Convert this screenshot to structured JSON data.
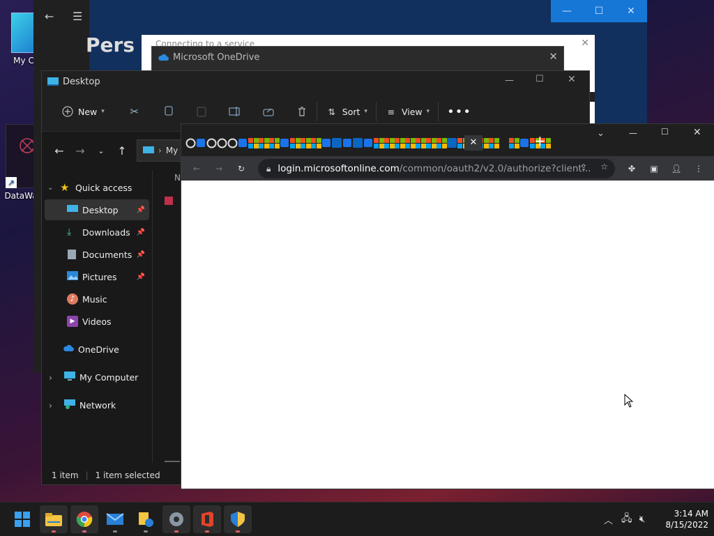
{
  "desktop": {
    "icons": [
      {
        "label": "My C"
      },
      {
        "label": "DataWa"
      }
    ]
  },
  "settings_window": {
    "title": "Pers",
    "controls": {
      "minimize": "—",
      "maximize": "☐",
      "close": "✕"
    }
  },
  "onedrive_back": {
    "status": "Connecting to a service"
  },
  "onedrive_dialog": {
    "title": "Microsoft OneDrive"
  },
  "explorer": {
    "title": "Desktop",
    "toolbar": {
      "new_label": "New",
      "sort_label": "Sort",
      "view_label": "View"
    },
    "address": {
      "path_segment": "My"
    },
    "nav": {
      "quick_access": "Quick access",
      "items": [
        {
          "label": "Desktop",
          "pinned": true
        },
        {
          "label": "Downloads",
          "pinned": true
        },
        {
          "label": "Documents",
          "pinned": true
        },
        {
          "label": "Pictures",
          "pinned": true
        },
        {
          "label": "Music",
          "pinned": false
        },
        {
          "label": "Videos",
          "pinned": false
        }
      ],
      "onedrive": "OneDrive",
      "my_computer": "My Computer",
      "network": "Network"
    },
    "status": {
      "count": "1 item",
      "selected": "1 item selected"
    },
    "column_header_fragment": "N"
  },
  "chrome": {
    "url_host": "login.microsoftonline.com",
    "url_path": "/common/oauth2/v2.0/authorize?client...",
    "tab_close": "✕",
    "new_tab": "+"
  },
  "taskbar": {
    "apps": [
      {
        "name": "start-icon"
      },
      {
        "name": "file-explorer-icon"
      },
      {
        "name": "chrome-icon"
      },
      {
        "name": "mail-icon"
      },
      {
        "name": "file-share-icon"
      },
      {
        "name": "settings-icon"
      },
      {
        "name": "office-icon"
      },
      {
        "name": "security-shield-icon"
      }
    ],
    "time": "3:14 AM",
    "date": "8/15/2022"
  },
  "colors": {
    "accent": "#1777d6",
    "explorer_bg": "#191919",
    "chrome_toolbar": "#35363a",
    "taskbar": "#1c1c1c"
  }
}
